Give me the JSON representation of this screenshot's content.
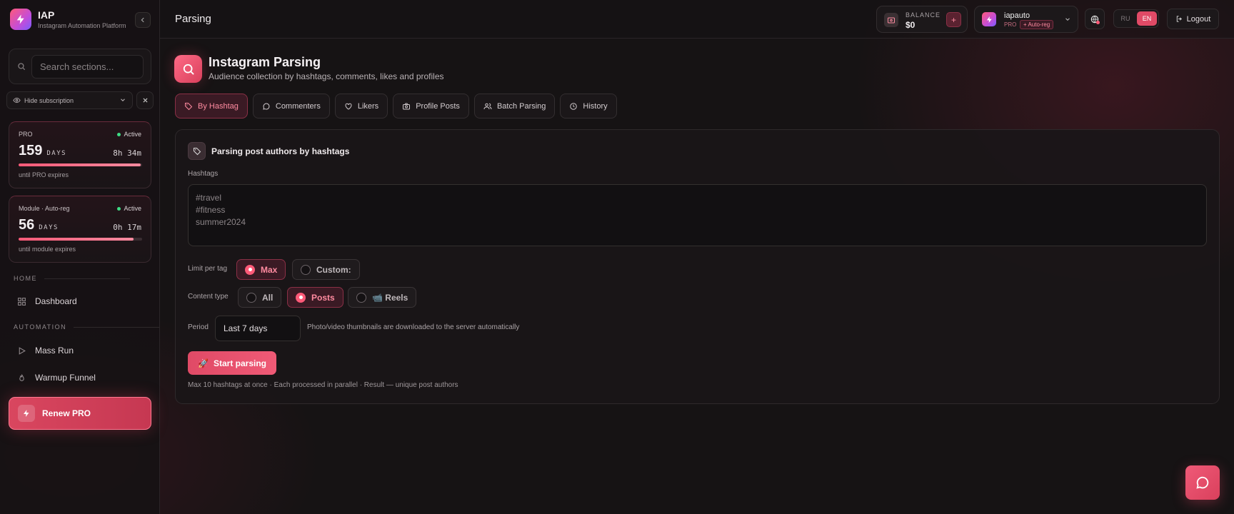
{
  "brand": {
    "title": "IAP",
    "subtitle": "Instagram Automation Platform",
    "logo_icon": "lightning-icon"
  },
  "sidebar": {
    "search_placeholder": "Search sections...",
    "hide_subscription_label": "Hide subscription",
    "subscriptions": [
      {
        "label": "PRO",
        "status": "Active",
        "days": "159",
        "days_unit": "DAYS",
        "time": "8h 34m",
        "progress": 0.99,
        "until": "until PRO expires"
      },
      {
        "label": "Module · Auto-reg",
        "status": "Active",
        "days": "56",
        "days_unit": "DAYS",
        "time": "0h 17m",
        "progress": 0.93,
        "until": "until module expires"
      }
    ],
    "sections": [
      {
        "title": "HOME",
        "items": [
          {
            "label": "Dashboard",
            "icon": "grid-icon"
          }
        ]
      },
      {
        "title": "AUTOMATION",
        "items": [
          {
            "label": "Mass Run",
            "icon": "play-icon"
          },
          {
            "label": "Warmup Funnel",
            "icon": "flame-icon"
          }
        ]
      }
    ],
    "renew_label": "Renew PRO"
  },
  "header": {
    "crumb": "Parsing",
    "balance_label": "BALANCE",
    "balance_value": "$0",
    "add_label": "+",
    "username": "iapauto",
    "tier": "PRO",
    "tier_badge": "+ Auto-reg",
    "lang_options": [
      "RU",
      "EN"
    ],
    "lang_active": "EN",
    "logout_label": "Logout"
  },
  "main": {
    "title": "Instagram Parsing",
    "subtitle": "Audience collection by hashtags, comments, likes and profiles",
    "tabs": [
      {
        "label": "By Hashtag",
        "icon": "tag-icon",
        "active": true
      },
      {
        "label": "Commenters",
        "icon": "comment-icon",
        "active": false
      },
      {
        "label": "Likers",
        "icon": "heart-icon",
        "active": false
      },
      {
        "label": "Profile Posts",
        "icon": "camera-icon",
        "active": false
      },
      {
        "label": "Batch Parsing",
        "icon": "users-icon",
        "active": false
      },
      {
        "label": "History",
        "icon": "clock-icon",
        "active": false
      }
    ],
    "panel": {
      "title": "Parsing post authors by hashtags",
      "hashtags_label": "Hashtags",
      "hashtags_placeholder": "#travel\n#fitness\nsummer2024",
      "limit_label": "Limit per tag",
      "limit_options": [
        "Max",
        "Custom:"
      ],
      "limit_selected": "Max",
      "content_label": "Content type",
      "content_options": [
        "All",
        "Posts",
        "📹 Reels"
      ],
      "content_selected": "Posts",
      "period_label": "Period",
      "period_value": "Last 7 days",
      "period_note": "Photo/video thumbnails are downloaded to the server automatically",
      "start_label": "Start parsing",
      "start_icon": "🚀",
      "footnote": "Max 10 hashtags at once · Each processed in parallel · Result — unique post authors"
    }
  },
  "colors": {
    "accent": "#e04a66",
    "accent_soft": "#ff8ba0",
    "active_dot": "#3ddc84",
    "bg": "#161314"
  }
}
